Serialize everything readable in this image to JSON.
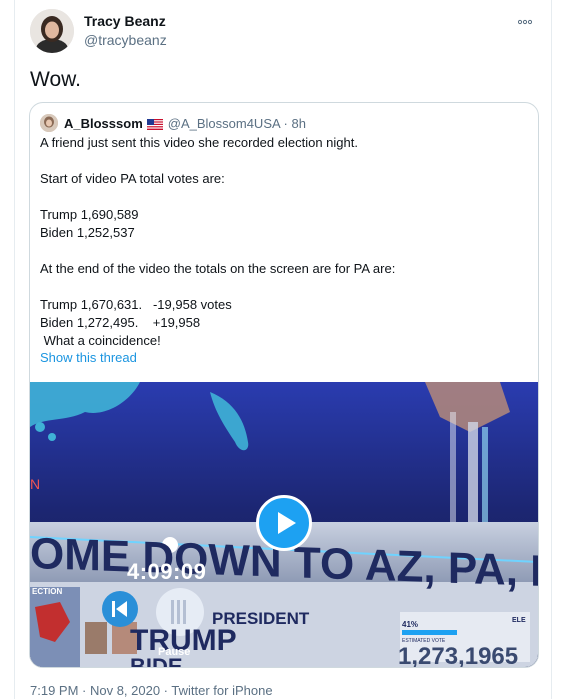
{
  "tweet": {
    "author_name": "Tracy Beanz",
    "author_handle": "@tracybeanz",
    "text": "Wow.",
    "timestamp": "7:19 PM · Nov 8, 2020 · Twitter for iPhone"
  },
  "quoted": {
    "name": "A_Blosssom",
    "handle_time": "@A_Blossom4USA · 8h",
    "body": "A friend just sent this video she recorded election night.\n\nStart of video PA total votes are:\n\nTrump 1,690,589\nBiden 1,252,537\n\nAt the end of the video the totals on the screen are for PA are:\n\nTrump 1,670,631.   -19,958 votes\nBiden 1,272,495.    +19,958\n What a coincidence!",
    "show_thread": "Show this thread",
    "video": {
      "banner": "OME DOWN TO AZ, PA, MI,",
      "left_tag": "N",
      "election": "ECTION",
      "president": "PRESIDENT",
      "candidate": "TRUMP",
      "candidate2": "BIDE",
      "pct": "41%",
      "est": "ESTIMATED VOTE",
      "count": "1,273,1965",
      "time": "4:09:09",
      "pause_label": "Pause",
      "corner": "ELE"
    }
  },
  "colors": {
    "accent": "#1da1f2",
    "muted": "#5b7083",
    "text": "#0f1419",
    "border": "#cfd9de"
  },
  "icons": {
    "more": "more-dots-icon",
    "play": "play-icon",
    "rewind": "skip-back-icon",
    "pause": "pause-icon",
    "flag": "us-flag-icon"
  }
}
